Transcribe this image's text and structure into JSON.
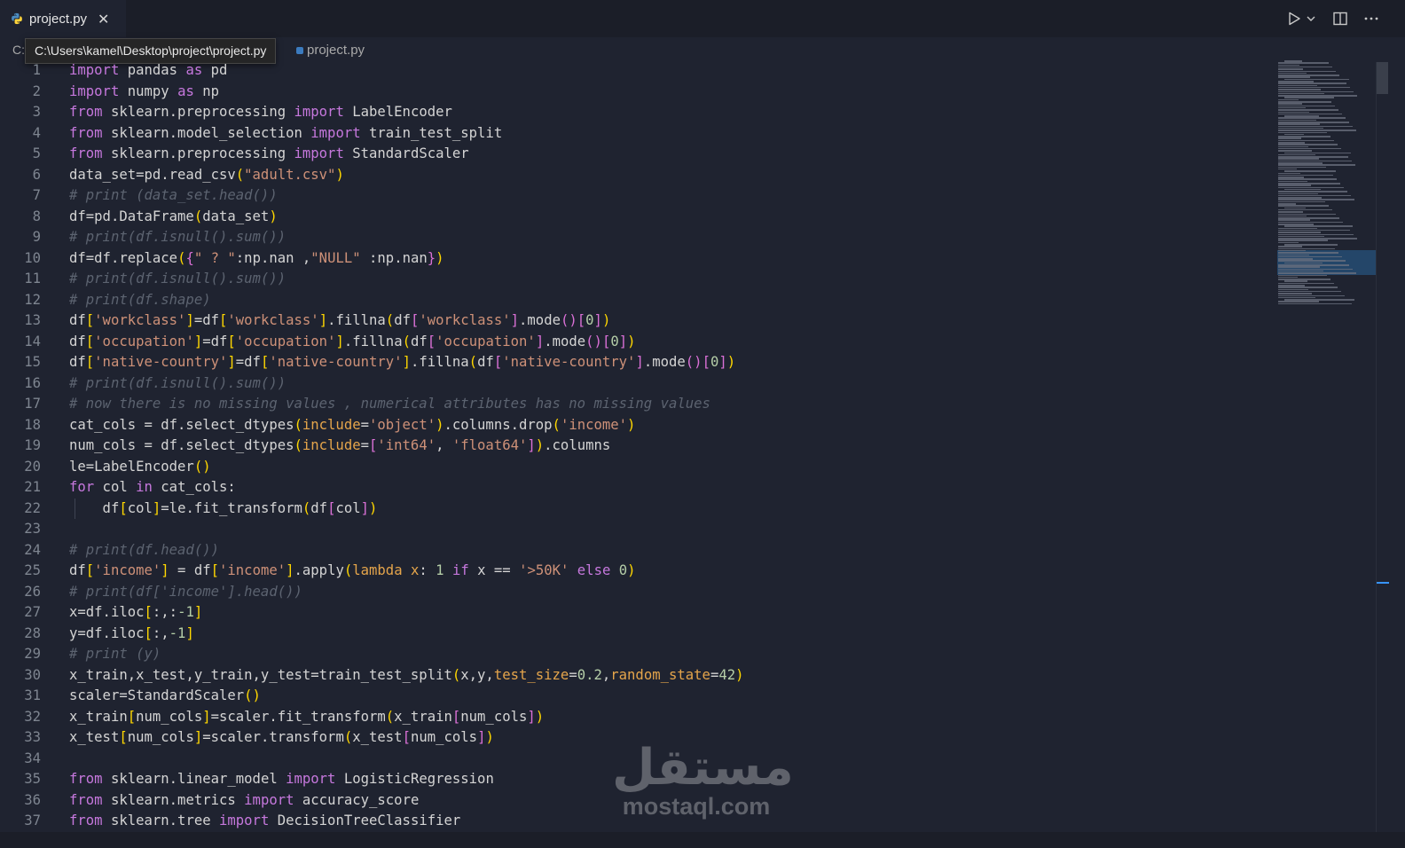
{
  "tab": {
    "label": "project.py",
    "close_glyph": "✕"
  },
  "breadcrumb": {
    "drive": "C:",
    "tooltip": "C:\\Users\\kamel\\Desktop\\project\\project.py",
    "file": "project.py"
  },
  "toolbar": {
    "run_icon": "run-icon",
    "split_icon": "split-editor-icon",
    "more_icon": "more-icon"
  },
  "code_lines": [
    [
      [
        "import",
        "kw"
      ],
      [
        " pandas ",
        "var"
      ],
      [
        "as",
        "kw"
      ],
      [
        " pd",
        "var"
      ]
    ],
    [
      [
        "import",
        "kw"
      ],
      [
        " numpy ",
        "var"
      ],
      [
        "as",
        "kw"
      ],
      [
        " np",
        "var"
      ]
    ],
    [
      [
        "from",
        "kw"
      ],
      [
        " sklearn.preprocessing ",
        "var"
      ],
      [
        "import",
        "kw"
      ],
      [
        " LabelEncoder",
        "var"
      ]
    ],
    [
      [
        "from",
        "kw"
      ],
      [
        " sklearn.model_selection ",
        "var"
      ],
      [
        "import",
        "kw"
      ],
      [
        " train_test_split",
        "var"
      ]
    ],
    [
      [
        "from",
        "kw"
      ],
      [
        " sklearn.preprocessing ",
        "var"
      ],
      [
        "import",
        "kw"
      ],
      [
        " StandardScaler",
        "var"
      ]
    ],
    [
      [
        "data_set=pd.read_csv",
        "var"
      ],
      [
        "(",
        "br1"
      ],
      [
        "\"adult.csv\"",
        "str"
      ],
      [
        ")",
        "br1"
      ]
    ],
    [
      [
        "# print (data_set.head())",
        "cmt"
      ]
    ],
    [
      [
        "df=pd.DataFrame",
        "var"
      ],
      [
        "(",
        "br1"
      ],
      [
        "data_set",
        "var"
      ],
      [
        ")",
        "br1"
      ]
    ],
    [
      [
        "# print(df.isnull().sum())",
        "cmt"
      ]
    ],
    [
      [
        "df=df.replace",
        "var"
      ],
      [
        "(",
        "br1"
      ],
      [
        "{",
        "br2"
      ],
      [
        "\" ? \"",
        "str"
      ],
      [
        ":np.nan ,",
        "var"
      ],
      [
        "\"NULL\"",
        "str"
      ],
      [
        " :np.nan",
        "var"
      ],
      [
        "}",
        "br2"
      ],
      [
        ")",
        "br1"
      ]
    ],
    [
      [
        "# print(df.isnull().sum())",
        "cmt"
      ]
    ],
    [
      [
        "# print(df.shape)",
        "cmt"
      ]
    ],
    [
      [
        "df",
        "var"
      ],
      [
        "[",
        "br1"
      ],
      [
        "'workclass'",
        "str"
      ],
      [
        "]",
        "br1"
      ],
      [
        "=df",
        "var"
      ],
      [
        "[",
        "br1"
      ],
      [
        "'workclass'",
        "str"
      ],
      [
        "]",
        "br1"
      ],
      [
        ".fillna",
        "var"
      ],
      [
        "(",
        "br1"
      ],
      [
        "df",
        "var"
      ],
      [
        "[",
        "br2"
      ],
      [
        "'workclass'",
        "str"
      ],
      [
        "]",
        "br2"
      ],
      [
        ".mode",
        "var"
      ],
      [
        "()",
        "br2"
      ],
      [
        "[",
        "br2"
      ],
      [
        "0",
        "num"
      ],
      [
        "]",
        "br2"
      ],
      [
        ")",
        "br1"
      ]
    ],
    [
      [
        "df",
        "var"
      ],
      [
        "[",
        "br1"
      ],
      [
        "'occupation'",
        "str"
      ],
      [
        "]",
        "br1"
      ],
      [
        "=df",
        "var"
      ],
      [
        "[",
        "br1"
      ],
      [
        "'occupation'",
        "str"
      ],
      [
        "]",
        "br1"
      ],
      [
        ".fillna",
        "var"
      ],
      [
        "(",
        "br1"
      ],
      [
        "df",
        "var"
      ],
      [
        "[",
        "br2"
      ],
      [
        "'occupation'",
        "str"
      ],
      [
        "]",
        "br2"
      ],
      [
        ".mode",
        "var"
      ],
      [
        "()",
        "br2"
      ],
      [
        "[",
        "br2"
      ],
      [
        "0",
        "num"
      ],
      [
        "]",
        "br2"
      ],
      [
        ")",
        "br1"
      ]
    ],
    [
      [
        "df",
        "var"
      ],
      [
        "[",
        "br1"
      ],
      [
        "'native-country'",
        "str"
      ],
      [
        "]",
        "br1"
      ],
      [
        "=df",
        "var"
      ],
      [
        "[",
        "br1"
      ],
      [
        "'native-country'",
        "str"
      ],
      [
        "]",
        "br1"
      ],
      [
        ".fillna",
        "var"
      ],
      [
        "(",
        "br1"
      ],
      [
        "df",
        "var"
      ],
      [
        "[",
        "br2"
      ],
      [
        "'native-country'",
        "str"
      ],
      [
        "]",
        "br2"
      ],
      [
        ".mode",
        "var"
      ],
      [
        "()",
        "br2"
      ],
      [
        "[",
        "br2"
      ],
      [
        "0",
        "num"
      ],
      [
        "]",
        "br2"
      ],
      [
        ")",
        "br1"
      ]
    ],
    [
      [
        "# print(df.isnull().sum())",
        "cmt"
      ]
    ],
    [
      [
        "# now there is no missing values , numerical attributes has no missing values",
        "cmt"
      ]
    ],
    [
      [
        "cat_cols = df.select_dtypes",
        "var"
      ],
      [
        "(",
        "br1"
      ],
      [
        "include",
        "par"
      ],
      [
        "=",
        "var"
      ],
      [
        "'object'",
        "str"
      ],
      [
        ")",
        "br1"
      ],
      [
        ".columns.drop",
        "var"
      ],
      [
        "(",
        "br1"
      ],
      [
        "'income'",
        "str"
      ],
      [
        ")",
        "br1"
      ]
    ],
    [
      [
        "num_cols = df.select_dtypes",
        "var"
      ],
      [
        "(",
        "br1"
      ],
      [
        "include",
        "par"
      ],
      [
        "=",
        "var"
      ],
      [
        "[",
        "br2"
      ],
      [
        "'int64'",
        "str"
      ],
      [
        ", ",
        "var"
      ],
      [
        "'float64'",
        "str"
      ],
      [
        "]",
        "br2"
      ],
      [
        ")",
        "br1"
      ],
      [
        ".columns",
        "var"
      ]
    ],
    [
      [
        "le=LabelEncoder",
        "var"
      ],
      [
        "()",
        "br1"
      ]
    ],
    [
      [
        "for",
        "kw"
      ],
      [
        " col ",
        "var"
      ],
      [
        "in",
        "kw"
      ],
      [
        " cat_cols:",
        "var"
      ]
    ],
    [
      [
        "    df",
        "var"
      ],
      [
        "[",
        "br1"
      ],
      [
        "col",
        "var"
      ],
      [
        "]",
        "br1"
      ],
      [
        "=le.fit_transform",
        "var"
      ],
      [
        "(",
        "br1"
      ],
      [
        "df",
        "var"
      ],
      [
        "[",
        "br2"
      ],
      [
        "col",
        "var"
      ],
      [
        "]",
        "br2"
      ],
      [
        ")",
        "br1"
      ]
    ],
    [],
    [
      [
        "# print(df.head())",
        "cmt"
      ]
    ],
    [
      [
        "df",
        "var"
      ],
      [
        "[",
        "br1"
      ],
      [
        "'income'",
        "str"
      ],
      [
        "]",
        "br1"
      ],
      [
        " = df",
        "var"
      ],
      [
        "[",
        "br1"
      ],
      [
        "'income'",
        "str"
      ],
      [
        "]",
        "br1"
      ],
      [
        ".apply",
        "var"
      ],
      [
        "(",
        "br1"
      ],
      [
        "lambda",
        "par"
      ],
      [
        " ",
        "var"
      ],
      [
        "x",
        "par"
      ],
      [
        ": ",
        "var"
      ],
      [
        "1",
        "num"
      ],
      [
        " ",
        "var"
      ],
      [
        "if",
        "kw"
      ],
      [
        " x == ",
        "var"
      ],
      [
        "'>50K'",
        "str"
      ],
      [
        " ",
        "var"
      ],
      [
        "else",
        "kw"
      ],
      [
        " ",
        "var"
      ],
      [
        "0",
        "num"
      ],
      [
        ")",
        "br1"
      ]
    ],
    [
      [
        "# print(df['income'].head())",
        "cmt"
      ]
    ],
    [
      [
        "x=df.iloc",
        "var"
      ],
      [
        "[",
        "br1"
      ],
      [
        ":,:",
        "var"
      ],
      [
        "-1",
        "num"
      ],
      [
        "]",
        "br1"
      ]
    ],
    [
      [
        "y=df.iloc",
        "var"
      ],
      [
        "[",
        "br1"
      ],
      [
        ":,",
        "var"
      ],
      [
        "-1",
        "num"
      ],
      [
        "]",
        "br1"
      ]
    ],
    [
      [
        "# print (y)",
        "cmt"
      ]
    ],
    [
      [
        "x_train,x_test,y_train,y_test=train_test_split",
        "var"
      ],
      [
        "(",
        "br1"
      ],
      [
        "x,y,",
        "var"
      ],
      [
        "test_size",
        "par"
      ],
      [
        "=",
        "var"
      ],
      [
        "0.2",
        "num"
      ],
      [
        ",",
        "var"
      ],
      [
        "random_state",
        "par"
      ],
      [
        "=",
        "var"
      ],
      [
        "42",
        "num"
      ],
      [
        ")",
        "br1"
      ]
    ],
    [
      [
        "scaler=StandardScaler",
        "var"
      ],
      [
        "()",
        "br1"
      ]
    ],
    [
      [
        "x_train",
        "var"
      ],
      [
        "[",
        "br1"
      ],
      [
        "num_cols",
        "var"
      ],
      [
        "]",
        "br1"
      ],
      [
        "=scaler.fit_transform",
        "var"
      ],
      [
        "(",
        "br1"
      ],
      [
        "x_train",
        "var"
      ],
      [
        "[",
        "br2"
      ],
      [
        "num_cols",
        "var"
      ],
      [
        "]",
        "br2"
      ],
      [
        ")",
        "br1"
      ]
    ],
    [
      [
        "x_test",
        "var"
      ],
      [
        "[",
        "br1"
      ],
      [
        "num_cols",
        "var"
      ],
      [
        "]",
        "br1"
      ],
      [
        "=scaler.transform",
        "var"
      ],
      [
        "(",
        "br1"
      ],
      [
        "x_test",
        "var"
      ],
      [
        "[",
        "br2"
      ],
      [
        "num_cols",
        "var"
      ],
      [
        "]",
        "br2"
      ],
      [
        ")",
        "br1"
      ]
    ],
    [],
    [
      [
        "from",
        "kw"
      ],
      [
        " sklearn.linear_model ",
        "var"
      ],
      [
        "import",
        "kw"
      ],
      [
        " LogisticRegression",
        "var"
      ]
    ],
    [
      [
        "from",
        "kw"
      ],
      [
        " sklearn.metrics ",
        "var"
      ],
      [
        "import",
        "kw"
      ],
      [
        " accuracy_score",
        "var"
      ]
    ],
    [
      [
        "from",
        "kw"
      ],
      [
        " sklearn.tree ",
        "var"
      ],
      [
        "import",
        "kw"
      ],
      [
        " DecisionTreeClassifier",
        "var"
      ]
    ]
  ],
  "watermark": {
    "arabic": "مستقل",
    "latin": "mostaql.com"
  },
  "colors": {
    "background": "#1f2330",
    "keyword": "#c678dd",
    "string": "#ce9178",
    "comment": "#5c6370",
    "bracket_gold": "#ffd700",
    "bracket_pink": "#da70d6"
  }
}
